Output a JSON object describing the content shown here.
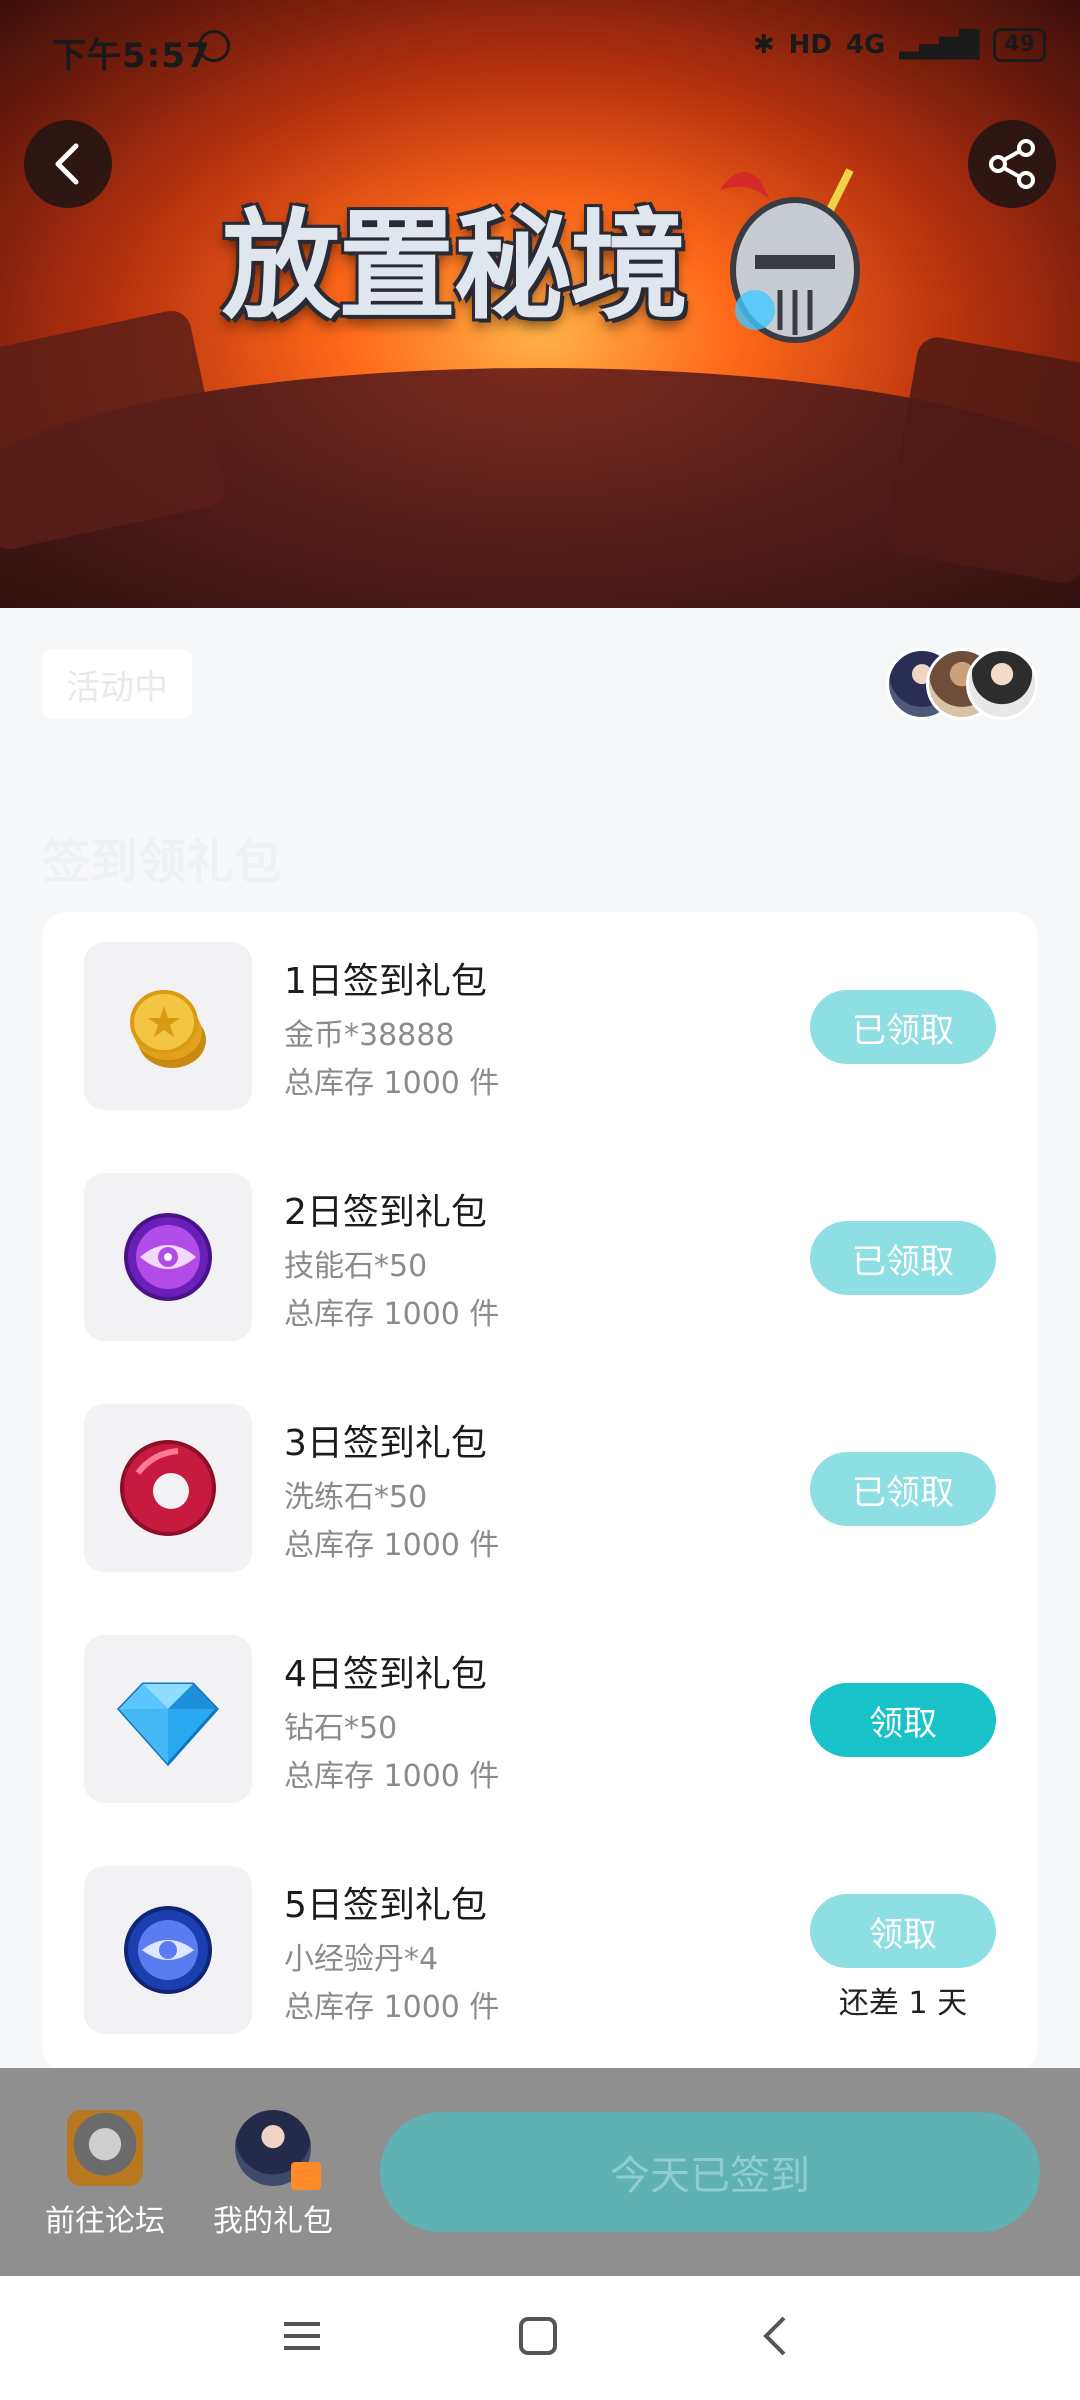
{
  "status_bar": {
    "time": "下午5:57",
    "network": "4G",
    "hd": "HD",
    "battery": "49"
  },
  "banner": {
    "title": "放置秘境"
  },
  "activity": {
    "status": "活动中",
    "section_title": "签到领礼包"
  },
  "gifts": [
    {
      "name": "1日签到礼包",
      "desc": "金币*38888",
      "stock": "总库存 1000 件",
      "button": "已领取",
      "state": "claimed"
    },
    {
      "name": "2日签到礼包",
      "desc": "技能石*50",
      "stock": "总库存 1000 件",
      "button": "已领取",
      "state": "claimed"
    },
    {
      "name": "3日签到礼包",
      "desc": "洗练石*50",
      "stock": "总库存 1000 件",
      "button": "已领取",
      "state": "claimed"
    },
    {
      "name": "4日签到礼包",
      "desc": "钻石*50",
      "stock": "总库存 1000 件",
      "button": "领取",
      "state": "active"
    },
    {
      "name": "5日签到礼包",
      "desc": "小经验丹*4",
      "stock": "总库存 1000 件",
      "button": "领取",
      "state": "locked",
      "note": "还差 1 天"
    }
  ],
  "bottom_bar": {
    "forum_label": "前往论坛",
    "gift_label": "我的礼包",
    "signed_button": "今天已签到"
  },
  "icons": {
    "coin": "coin-icon",
    "skill_stone": "skill-stone-icon",
    "refine_stone": "refine-stone-icon",
    "diamond": "diamond-icon",
    "exp_pill": "exp-pill-icon"
  },
  "colors": {
    "accent": "#19c1c9",
    "claimed": "#8ddfe3",
    "signed_btn": "#5fb1b4"
  }
}
